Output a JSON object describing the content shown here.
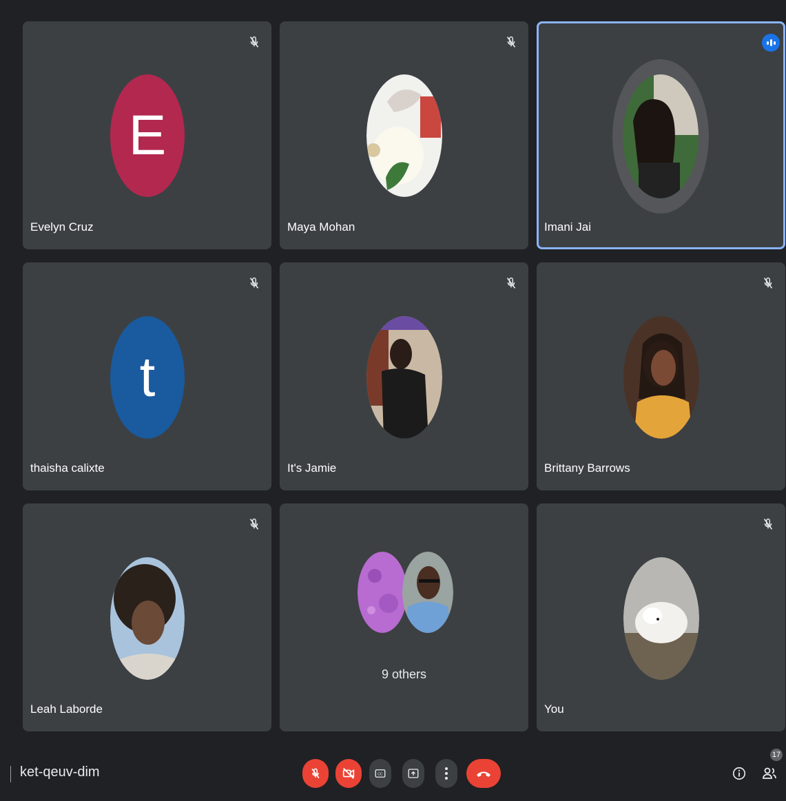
{
  "meeting": {
    "code": "ket-qeuv-dim",
    "participant_count": "17"
  },
  "tiles": [
    {
      "name": "Evelyn Cruz",
      "initial": "E",
      "avatar_color": "#b3284f",
      "muted": true
    },
    {
      "name": "Maya Mohan",
      "muted": true
    },
    {
      "name": "Imani Jai",
      "muted": false,
      "speaking": true
    },
    {
      "name": "thaisha calixte",
      "initial": "t",
      "avatar_color": "#1a5a9e",
      "muted": true
    },
    {
      "name": "It's Jamie",
      "muted": true
    },
    {
      "name": "Brittany Barrows",
      "muted": true
    },
    {
      "name": "Leah Laborde",
      "muted": true
    },
    {
      "others_label": "9 others",
      "muted": false
    },
    {
      "name": "You",
      "muted": true
    }
  ],
  "controls": {
    "mic": "mic-off-icon",
    "camera": "camera-off-icon",
    "captions": "captions-icon",
    "present": "present-screen-icon",
    "more": "more-options-icon",
    "end": "end-call-icon",
    "info": "info-icon",
    "people": "people-icon"
  },
  "colors": {
    "background": "#202124",
    "tile": "#3c4043",
    "danger": "#ea4335",
    "accent": "#1a73e8",
    "speaking_border": "#8ab4f8"
  }
}
